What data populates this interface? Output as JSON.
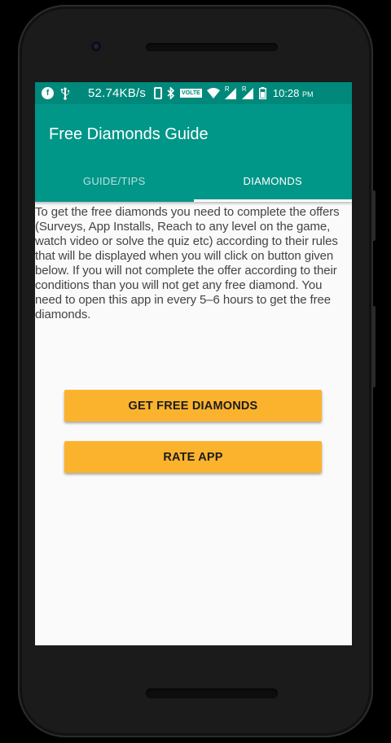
{
  "status_bar": {
    "speed": "52.74KB/s",
    "volte": "VOLTE",
    "sim1_label": "R",
    "sim2_label": "R",
    "time": "10:28",
    "time_suffix": "PM",
    "background_color": "#00897b"
  },
  "app_bar": {
    "title": "Free Diamonds Guide",
    "background_color": "#009688"
  },
  "tabs": [
    {
      "label": "GUIDE/TIPS",
      "selected": false
    },
    {
      "label": "DIAMONDS",
      "selected": true
    }
  ],
  "content": {
    "description": "To get the free diamonds you need to complete the offers (Surveys, App Installs, Reach to any level on the game, watch video or solve the quiz etc) according to their rules that will be displayed when you will click on button given below. If you will not complete the offer according to their conditions than you will not get any free diamond. You need to open this app in every 5–6 hours to get the free diamonds."
  },
  "buttons": {
    "get_free_diamonds": "GET FREE DIAMONDS",
    "rate_app": "RATE APP",
    "color": "#fbb32e"
  }
}
